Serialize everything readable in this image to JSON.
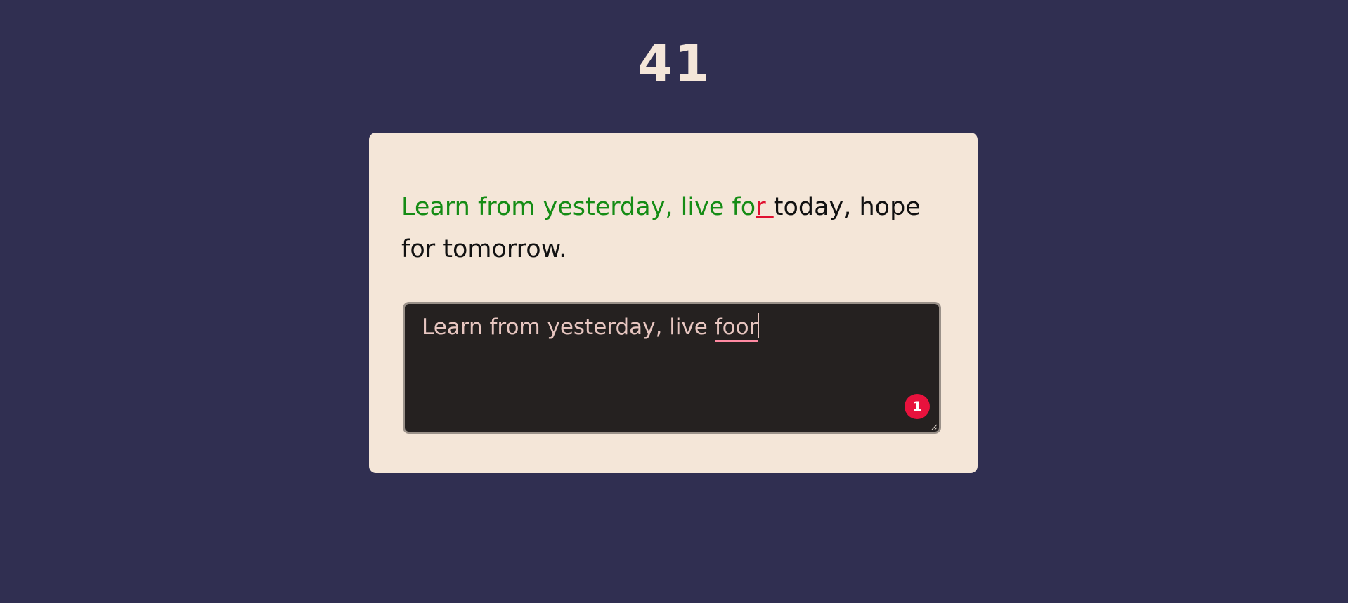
{
  "timer": {
    "value": "41"
  },
  "quote": {
    "segments": [
      {
        "text": "Learn from yesterday, live fo",
        "state": "correct"
      },
      {
        "text": "r ",
        "state": "wrong"
      },
      {
        "text": "today, hope for tomorrow.",
        "state": "pending"
      }
    ]
  },
  "input": {
    "prefix": "Learn from yesterday, live ",
    "misspelled_word": "foor"
  },
  "error_badge": {
    "count": "1"
  },
  "colors": {
    "background": "#302f51",
    "card": "#f4e6d8",
    "correct": "#158c15",
    "wrong": "#e01030",
    "pending": "#111111",
    "input_bg": "#252120",
    "badge": "#e8123d"
  },
  "icons": {
    "resize": "resize-handle-icon"
  }
}
